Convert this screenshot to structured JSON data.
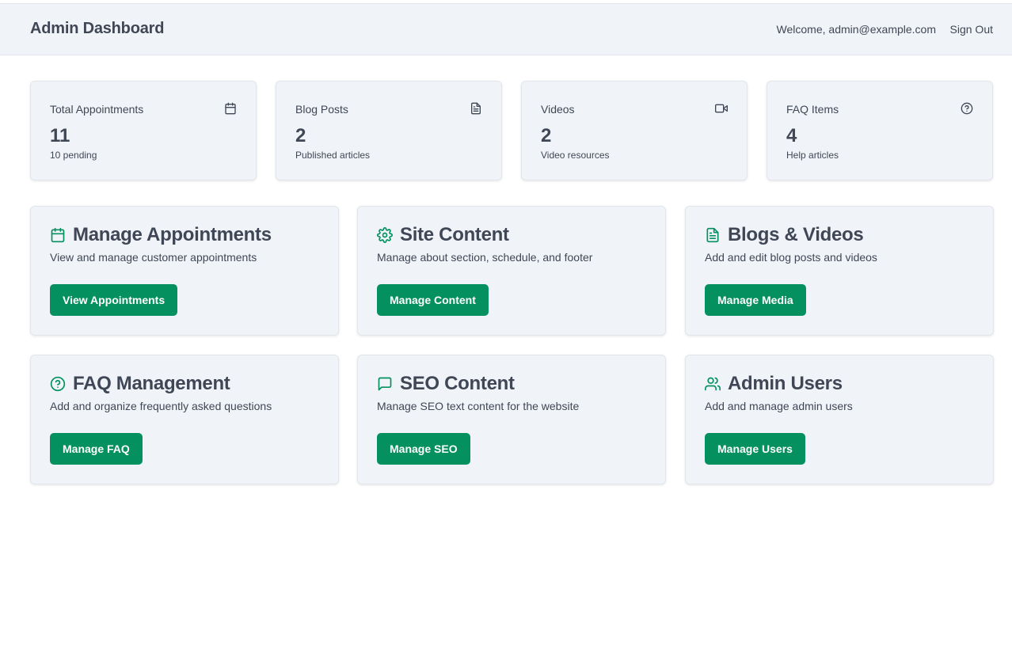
{
  "header": {
    "title": "Admin Dashboard",
    "welcome": "Welcome, admin@example.com",
    "sign_out": "Sign Out"
  },
  "stats": [
    {
      "label": "Total Appointments",
      "value": "11",
      "sub": "10 pending",
      "icon": "calendar-icon"
    },
    {
      "label": "Blog Posts",
      "value": "2",
      "sub": "Published articles",
      "icon": "file-text-icon"
    },
    {
      "label": "Videos",
      "value": "2",
      "sub": "Video resources",
      "icon": "video-icon"
    },
    {
      "label": "FAQ Items",
      "value": "4",
      "sub": "Help articles",
      "icon": "help-circle-icon"
    }
  ],
  "features": [
    {
      "title": "Manage Appointments",
      "description": "View and manage customer appointments",
      "button": "View Appointments",
      "icon": "calendar-icon"
    },
    {
      "title": "Site Content",
      "description": "Manage about section, schedule, and footer",
      "button": "Manage Content",
      "icon": "gear-icon"
    },
    {
      "title": "Blogs & Videos",
      "description": "Add and edit blog posts and videos",
      "button": "Manage Media",
      "icon": "file-text-icon"
    },
    {
      "title": "FAQ Management",
      "description": "Add and organize frequently asked questions",
      "button": "Manage FAQ",
      "icon": "help-circle-icon"
    },
    {
      "title": "SEO Content",
      "description": "Manage SEO text content for the website",
      "button": "Manage SEO",
      "icon": "message-square-icon"
    },
    {
      "title": "Admin Users",
      "description": "Add and manage admin users",
      "button": "Manage Users",
      "icon": "users-icon"
    }
  ],
  "colors": {
    "accent": "#04915f",
    "card_bg": "#f0f3f7",
    "text": "#3f4756"
  }
}
